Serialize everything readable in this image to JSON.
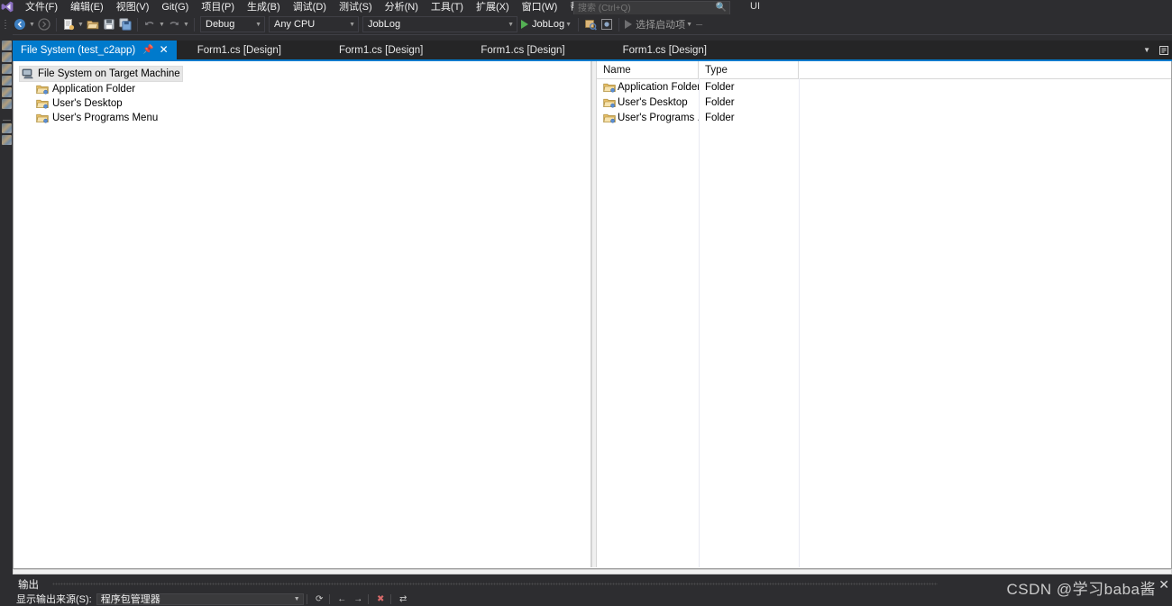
{
  "window": {
    "logo_icon": "visual-studio-logo",
    "ui_badge": "UI"
  },
  "menubar": {
    "items": [
      {
        "label": "文件(F)"
      },
      {
        "label": "编辑(E)"
      },
      {
        "label": "视图(V)"
      },
      {
        "label": "Git(G)"
      },
      {
        "label": "项目(P)"
      },
      {
        "label": "生成(B)"
      },
      {
        "label": "调试(D)"
      },
      {
        "label": "测试(S)"
      },
      {
        "label": "分析(N)"
      },
      {
        "label": "工具(T)"
      },
      {
        "label": "扩展(X)"
      },
      {
        "label": "窗口(W)"
      },
      {
        "label": "帮助(H)"
      }
    ],
    "search": {
      "placeholder": "搜索 (Ctrl+Q)",
      "value": "",
      "icon": "search-icon"
    }
  },
  "toolbar": {
    "icons": [
      {
        "name": "navigate-backward-icon"
      },
      {
        "name": "navigate-forward-icon"
      },
      {
        "name": "new-project-icon"
      },
      {
        "name": "open-file-icon"
      },
      {
        "name": "save-icon"
      },
      {
        "name": "save-all-icon"
      },
      {
        "name": "undo-icon"
      },
      {
        "name": "redo-icon"
      }
    ],
    "config_combo": {
      "value": "Debug"
    },
    "platform_combo": {
      "value": "Any CPU"
    },
    "project_combo": {
      "value": "JobLog"
    },
    "run_button": {
      "label": "JobLog"
    },
    "startup_button": {
      "label": "选择启动项"
    },
    "right_icons": [
      {
        "name": "attach-to-process-icon"
      },
      {
        "name": "preview-icon"
      }
    ]
  },
  "tabs": {
    "items": [
      {
        "label": "File System (test_c2app)",
        "active": true,
        "pin_icon": "pin-icon",
        "close_icon": "close-icon"
      },
      {
        "label": "Form1.cs [Design]",
        "active": false
      },
      {
        "label": "Form1.cs [Design]",
        "active": false
      },
      {
        "label": "Form1.cs [Design]",
        "active": false
      },
      {
        "label": "Form1.cs [Design]",
        "active": false
      }
    ],
    "overflow_icon": "chevron-down-icon",
    "right_icon": "tab-list-icon"
  },
  "left_tool_strip": {
    "icons": [
      {
        "name": "toolbox-icon"
      },
      {
        "name": "server-explorer-icon"
      },
      {
        "name": "data-sources-icon"
      },
      {
        "name": "notifications-icon"
      },
      {
        "name": "team-explorer-icon"
      },
      {
        "name": "solution-explorer-icon"
      },
      {
        "name": "properties-icon"
      },
      {
        "name": "class-view-icon"
      }
    ]
  },
  "file_system_editor": {
    "tree": {
      "root": {
        "label": "File System on Target Machine",
        "icon": "computer-icon",
        "selected": true
      },
      "children": [
        {
          "label": "Application Folder",
          "icon": "folder-icon"
        },
        {
          "label": "User's Desktop",
          "icon": "folder-icon"
        },
        {
          "label": "User's Programs Menu",
          "icon": "folder-icon"
        }
      ]
    },
    "list": {
      "columns": [
        "Name",
        "Type"
      ],
      "rows": [
        {
          "name": "Application Folder",
          "type": "Folder",
          "icon": "folder-icon"
        },
        {
          "name": "User's Desktop",
          "type": "Folder",
          "icon": "folder-icon"
        },
        {
          "name": "User's Programs ...",
          "type": "Folder",
          "icon": "folder-icon"
        }
      ]
    }
  },
  "output_panel": {
    "title": "输出",
    "source_label": "显示输出来源(S):",
    "source_value": "程序包管理器",
    "tools": [
      {
        "name": "clear-output-icon",
        "glyph": "⟳"
      },
      {
        "name": "previous-message-icon",
        "glyph": "←"
      },
      {
        "name": "next-message-icon",
        "glyph": "→"
      },
      {
        "name": "clear-all-icon",
        "glyph": "✖"
      },
      {
        "name": "toggle-wordwrap-icon",
        "glyph": "⇄"
      }
    ]
  },
  "watermark": {
    "text": "CSDN @学习baba酱",
    "close_icon": "close-icon"
  },
  "colors": {
    "accent": "#007acc",
    "chrome": "#2d2d30",
    "tabstrip": "#252526",
    "surface": "#ffffff",
    "play_green": "#54b054"
  }
}
